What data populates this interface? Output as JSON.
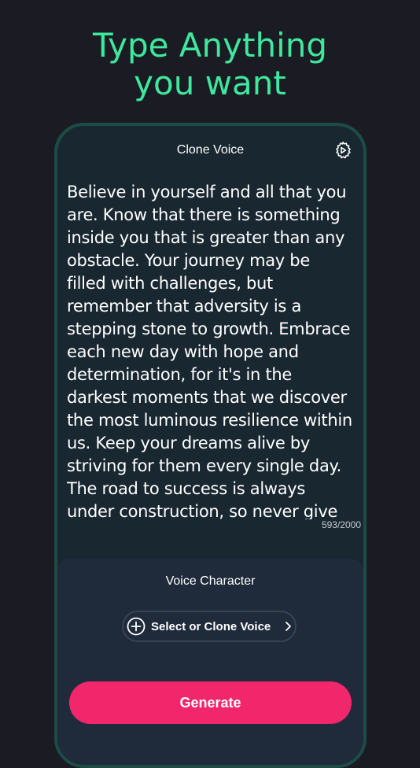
{
  "headline": {
    "line1": "Type Anything",
    "line2": "you want"
  },
  "header": {
    "title": "Clone Voice",
    "settings_icon": "gear-icon"
  },
  "editor": {
    "text": "Believe in yourself and all that you are. Know that there is something inside you that is greater than any obstacle. Your journey may be filled with challenges, but remember that adversity is a stepping stone to growth. Embrace each new day with hope and determination, for it's in the darkest moments that we discover the most luminous resilience within us. Keep your dreams alive by striving for them every single day. The road to success is always under construction, so never give up.",
    "counter": "593/2000"
  },
  "voice": {
    "section_title": "Voice Character",
    "select_label": "Select or Clone Voice",
    "select_icon": "plus-circle-icon",
    "chevron_icon": "chevron-right-icon"
  },
  "actions": {
    "generate_label": "Generate"
  },
  "colors": {
    "background": "#1a1b23",
    "headline": "#3ee89c",
    "phone_border": "#1d4c47",
    "phone_bg": "#192731",
    "panel_bg": "#1f2a3b",
    "generate_bg": "#f2266b"
  }
}
